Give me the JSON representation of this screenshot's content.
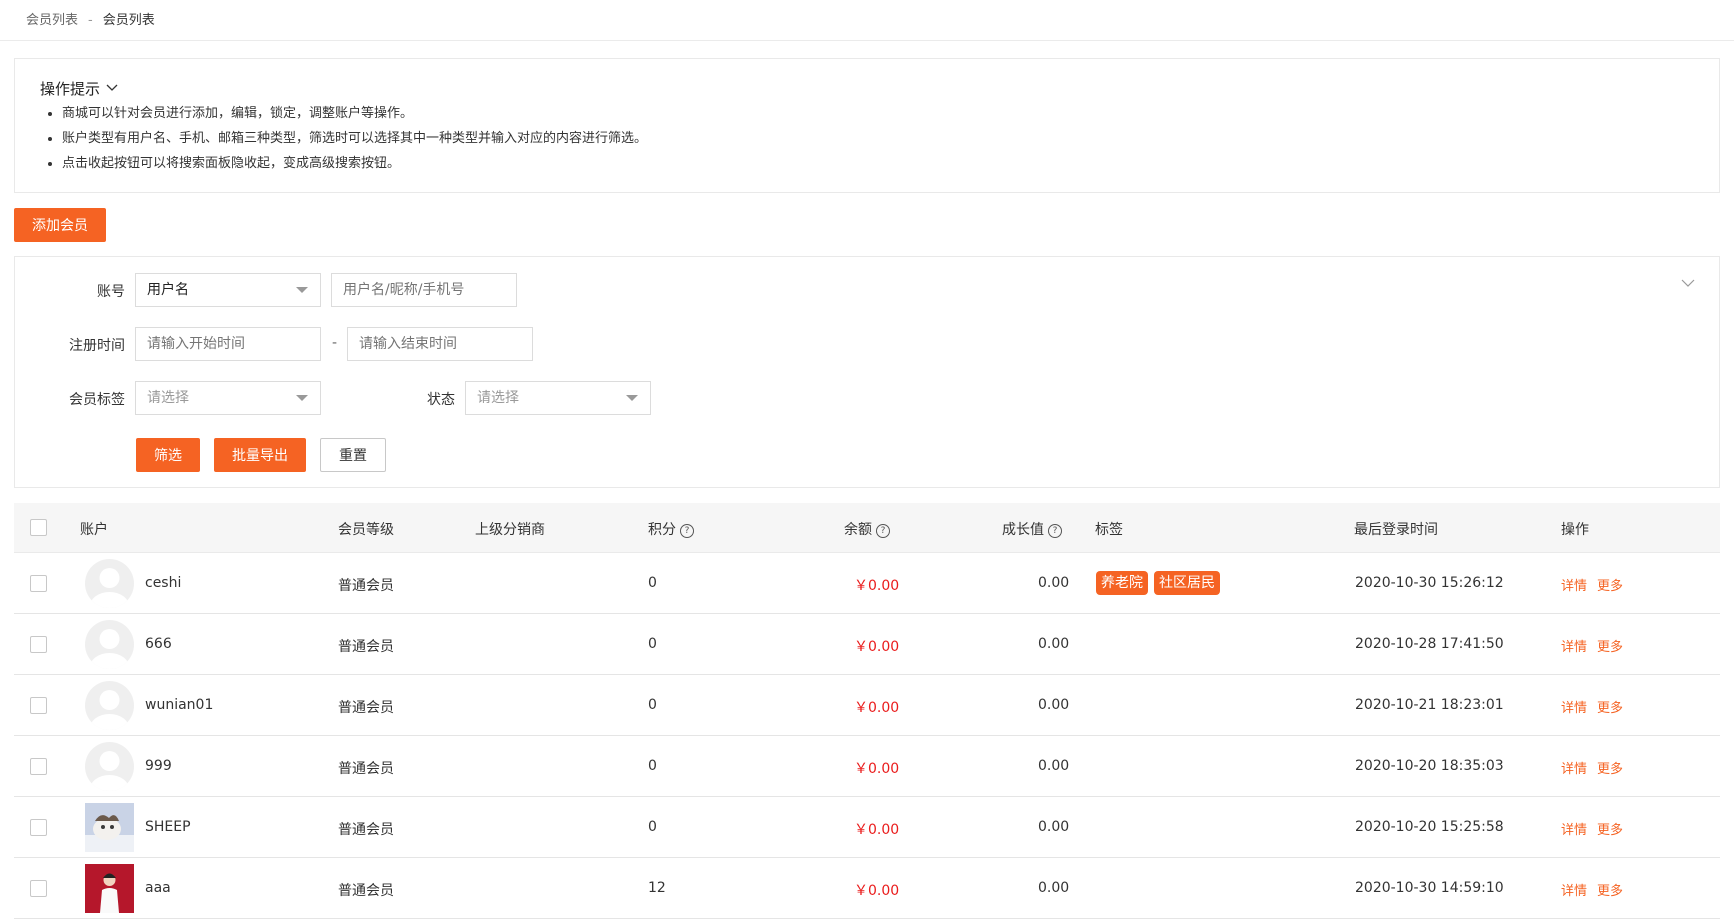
{
  "breadcrumb": {
    "parent": "会员列表",
    "separator": "-",
    "current": "会员列表"
  },
  "tips": {
    "title": "操作提示",
    "items": [
      "商城可以针对会员进行添加，编辑，锁定，调整账户等操作。",
      "账户类型有用户名、手机、邮箱三种类型，筛选时可以选择其中一种类型并输入对应的内容进行筛选。",
      "点击收起按钮可以将搜索面板隐收起，变成高级搜索按钮。"
    ]
  },
  "add_button": "添加会员",
  "filter": {
    "account_label": "账号",
    "account_type": "用户名",
    "account_placeholder": "用户名/昵称/手机号",
    "reg_time_label": "注册时间",
    "start_placeholder": "请输入开始时间",
    "range_dash": "-",
    "end_placeholder": "请输入结束时间",
    "tag_label": "会员标签",
    "tag_placeholder": "请选择",
    "status_label": "状态",
    "status_placeholder": "请选择",
    "filter_btn": "筛选",
    "export_btn": "批量导出",
    "reset_btn": "重置"
  },
  "table": {
    "headers": {
      "account": "账户",
      "level": "会员等级",
      "distributor": "上级分销商",
      "points": "积分",
      "balance": "余额",
      "growth": "成长值",
      "tags": "标签",
      "last_login": "最后登录时间",
      "actions": "操作"
    },
    "help_glyph": "?",
    "rows": [
      {
        "name": "ceshi",
        "level": "普通会员",
        "distributor": "",
        "points": "0",
        "balance": "￥0.00",
        "growth": "0.00",
        "tags": [
          "养老院",
          "社区居民"
        ],
        "last_login": "2020-10-30 15:26:12",
        "detail": "详情",
        "more": "更多"
      },
      {
        "name": "666",
        "level": "普通会员",
        "distributor": "",
        "points": "0",
        "balance": "￥0.00",
        "growth": "0.00",
        "tags": [],
        "last_login": "2020-10-28 17:41:50",
        "detail": "详情",
        "more": "更多"
      },
      {
        "name": "wunian01",
        "level": "普通会员",
        "distributor": "",
        "points": "0",
        "balance": "￥0.00",
        "growth": "0.00",
        "tags": [],
        "last_login": "2020-10-21 18:23:01",
        "detail": "详情",
        "more": "更多"
      },
      {
        "name": "999",
        "level": "普通会员",
        "distributor": "",
        "points": "0",
        "balance": "￥0.00",
        "growth": "0.00",
        "tags": [],
        "last_login": "2020-10-20 18:35:03",
        "detail": "详情",
        "more": "更多"
      },
      {
        "name": "SHEEP",
        "level": "普通会员",
        "distributor": "",
        "points": "0",
        "balance": "￥0.00",
        "growth": "0.00",
        "tags": [],
        "last_login": "2020-10-20 15:25:58",
        "detail": "详情",
        "more": "更多"
      },
      {
        "name": "aaa",
        "level": "普通会员",
        "distributor": "",
        "points": "12",
        "balance": "￥0.00",
        "growth": "0.00",
        "tags": [],
        "last_login": "2020-10-30 14:59:10",
        "detail": "详情",
        "more": "更多"
      }
    ]
  },
  "colors": {
    "accent": "#f56323",
    "money": "#ea1c1c"
  }
}
